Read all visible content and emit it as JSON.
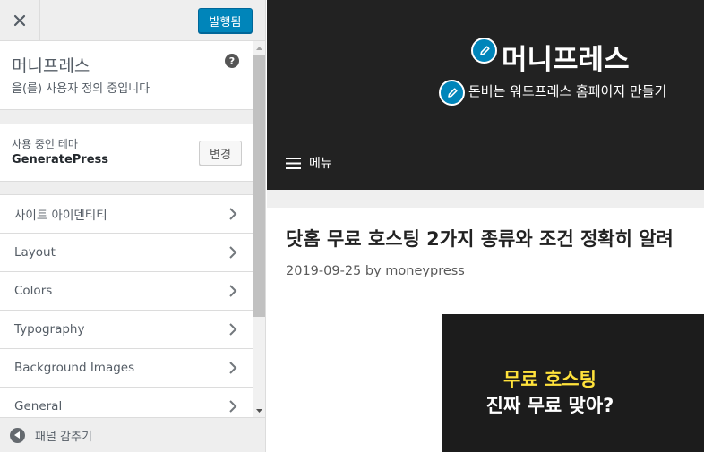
{
  "customizer": {
    "header": {
      "close_icon": "close-icon",
      "publish_label": "발행됨"
    },
    "info": {
      "title": "머니프레스",
      "subtitle": "을(를) 사용자 정의 중입니다",
      "help_label": "?"
    },
    "theme": {
      "label": "사용 중인 테마",
      "name": "GeneratePress",
      "change_label": "변경"
    },
    "sections": [
      {
        "label": "사이트 아이덴티티"
      },
      {
        "label": "Layout"
      },
      {
        "label": "Colors"
      },
      {
        "label": "Typography"
      },
      {
        "label": "Background Images"
      },
      {
        "label": "General"
      }
    ],
    "footer": {
      "collapse_label": "패널 감추기"
    }
  },
  "preview": {
    "site_title": "머니프레스",
    "site_description": "돈버는 워드프레스 홈페이지 만들기",
    "menu_label": "메뉴",
    "post": {
      "title": "닷홈 무료 호스팅 2가지 종류와 조건 정확히 알려",
      "date": "2019-09-25",
      "by": "by",
      "author": "moneypress",
      "thumb_line1": "무료 호스팅",
      "thumb_line2": "진짜 무료 맞아?"
    }
  },
  "colors": {
    "accent": "#0085ba",
    "header_bg": "#222222",
    "thumb_highlight": "#ffe23b"
  }
}
